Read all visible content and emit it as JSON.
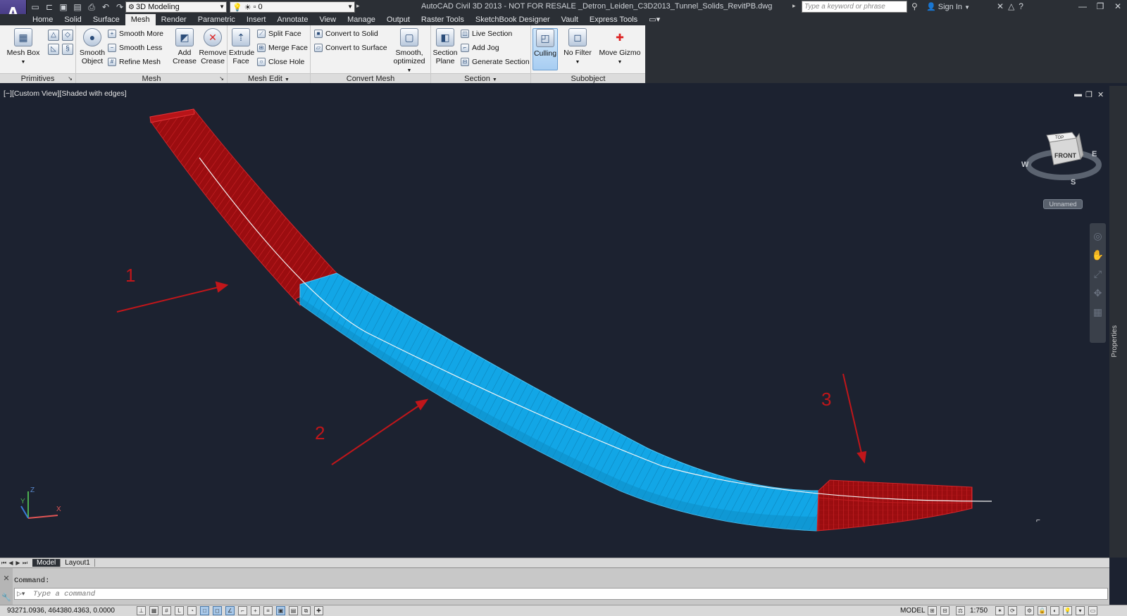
{
  "app": {
    "logo_glyph": "A",
    "window_title": "AutoCAD Civil 3D 2013 - NOT FOR RESALE    _Detron_Leiden_C3D2013_Tunnel_Solids_RevitPB.dwg",
    "workspace": "3D Modeling",
    "layer": "0",
    "search_placeholder": "Type a keyword or phrase",
    "sign_in": "Sign In"
  },
  "tabs": [
    "Home",
    "Solid",
    "Surface",
    "Mesh",
    "Render",
    "Parametric",
    "Insert",
    "Annotate",
    "View",
    "Manage",
    "Output",
    "Raster Tools",
    "SketchBook Designer",
    "Vault",
    "Express Tools"
  ],
  "active_tab": "Mesh",
  "ribbon": {
    "primitives": {
      "title": "Primitives",
      "mesh_box": "Mesh Box"
    },
    "mesh": {
      "title": "Mesh",
      "smooth_object": "Smooth Object",
      "smooth_more": "Smooth More",
      "smooth_less": "Smooth Less",
      "refine_mesh": "Refine Mesh",
      "add_crease": "Add Crease",
      "remove_crease": "Remove Crease"
    },
    "mesh_edit": {
      "title": "Mesh Edit",
      "extrude_face": "Extrude Face",
      "split_face": "Split Face",
      "merge_face": "Merge Face",
      "close_hole": "Close Hole"
    },
    "convert_mesh": {
      "title": "Convert Mesh",
      "convert_to_solid": "Convert to Solid",
      "convert_to_surface": "Convert to Surface",
      "smooth_optimized": "Smooth, optimized"
    },
    "section": {
      "title": "Section",
      "section_plane": "Section Plane",
      "live_section": "Live Section",
      "add_jog": "Add Jog",
      "generate_section": "Generate Section"
    },
    "subobject": {
      "title": "Subobject",
      "culling": "Culling",
      "no_filter": "No Filter",
      "move_gizmo": "Move Gizmo"
    }
  },
  "viewport": {
    "label": "[−][Custom View][Shaded with edges]",
    "viewcube": {
      "top": "TOP",
      "front": "FRONT",
      "compass": [
        "W",
        "S",
        "E"
      ],
      "ucs": "Unnamed"
    },
    "annotations": [
      "1",
      "2",
      "3"
    ],
    "colors": {
      "background": "#1c2230",
      "red_solid": "#9b0d10",
      "blue_solid": "#12a6e6",
      "annotation": "#c0161a"
    }
  },
  "properties_palette": "Properties",
  "layout_tabs": [
    "Model",
    "Layout1"
  ],
  "active_layout": "Model",
  "command": {
    "history": "Command:",
    "placeholder": "Type a command"
  },
  "status": {
    "coords": "93271.0936, 464380.4363, 0.0000",
    "model": "MODEL",
    "scale": "1:750"
  }
}
